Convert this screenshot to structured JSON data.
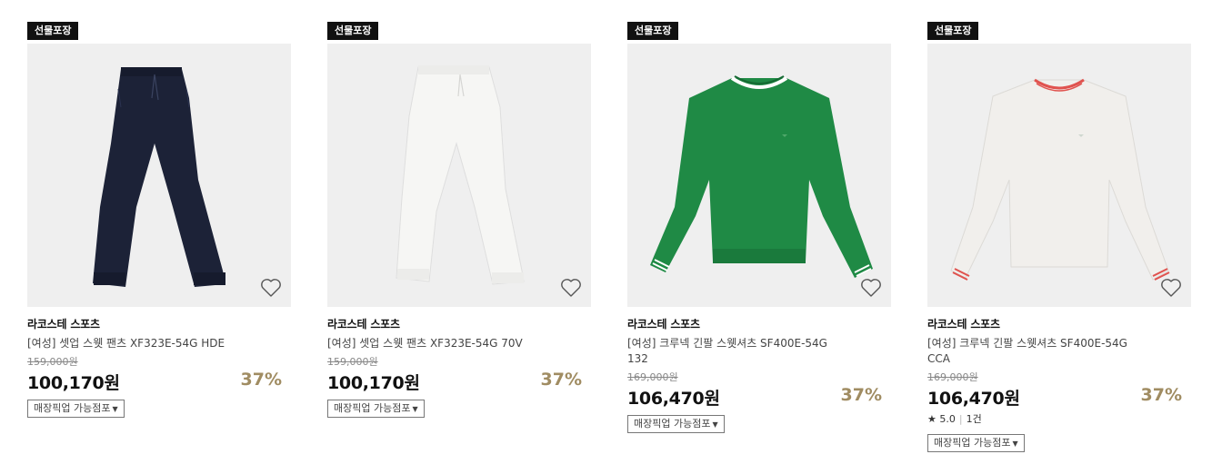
{
  "products": [
    {
      "badge": "선물포장",
      "brand": "라코스테 스포츠",
      "name": "[여성] 셋업 스웻 팬츠 XF323E-54G HDE",
      "original_price": "159,000원",
      "price": "100,170원",
      "discount": "37%",
      "pickup_label": "매장픽업 가능점포",
      "image_icon": "navy-sweatpants-image",
      "color": "#1c2237"
    },
    {
      "badge": "선물포장",
      "brand": "라코스테 스포츠",
      "name": "[여성] 셋업 스웻 팬츠 XF323E-54G 70V",
      "original_price": "159,000원",
      "price": "100,170원",
      "discount": "37%",
      "pickup_label": "매장픽업 가능점포",
      "image_icon": "white-sweatpants-image",
      "color": "#f4f4f2"
    },
    {
      "badge": "선물포장",
      "brand": "라코스테 스포츠",
      "name": "[여성] 크루넥 긴팔 스웻셔츠 SF400E-54G 132",
      "original_price": "169,000원",
      "price": "106,470원",
      "discount": "37%",
      "pickup_label": "매장픽업 가능점포",
      "image_icon": "green-sweatshirt-image",
      "color": "#1f8a45"
    },
    {
      "badge": "선물포장",
      "brand": "라코스테 스포츠",
      "name": "[여성] 크루넥 긴팔 스웻셔츠 SF400E-54G CCA",
      "original_price": "169,000원",
      "price": "106,470원",
      "discount": "37%",
      "rating": "★ 5.0",
      "review_count": "1건",
      "pickup_label": "매장픽업 가능점포",
      "image_icon": "white-sweatshirt-image",
      "color": "#efedea"
    }
  ],
  "colors": {
    "discount": "#a08c62",
    "badge_bg": "#111111",
    "image_bg": "#efefef"
  }
}
